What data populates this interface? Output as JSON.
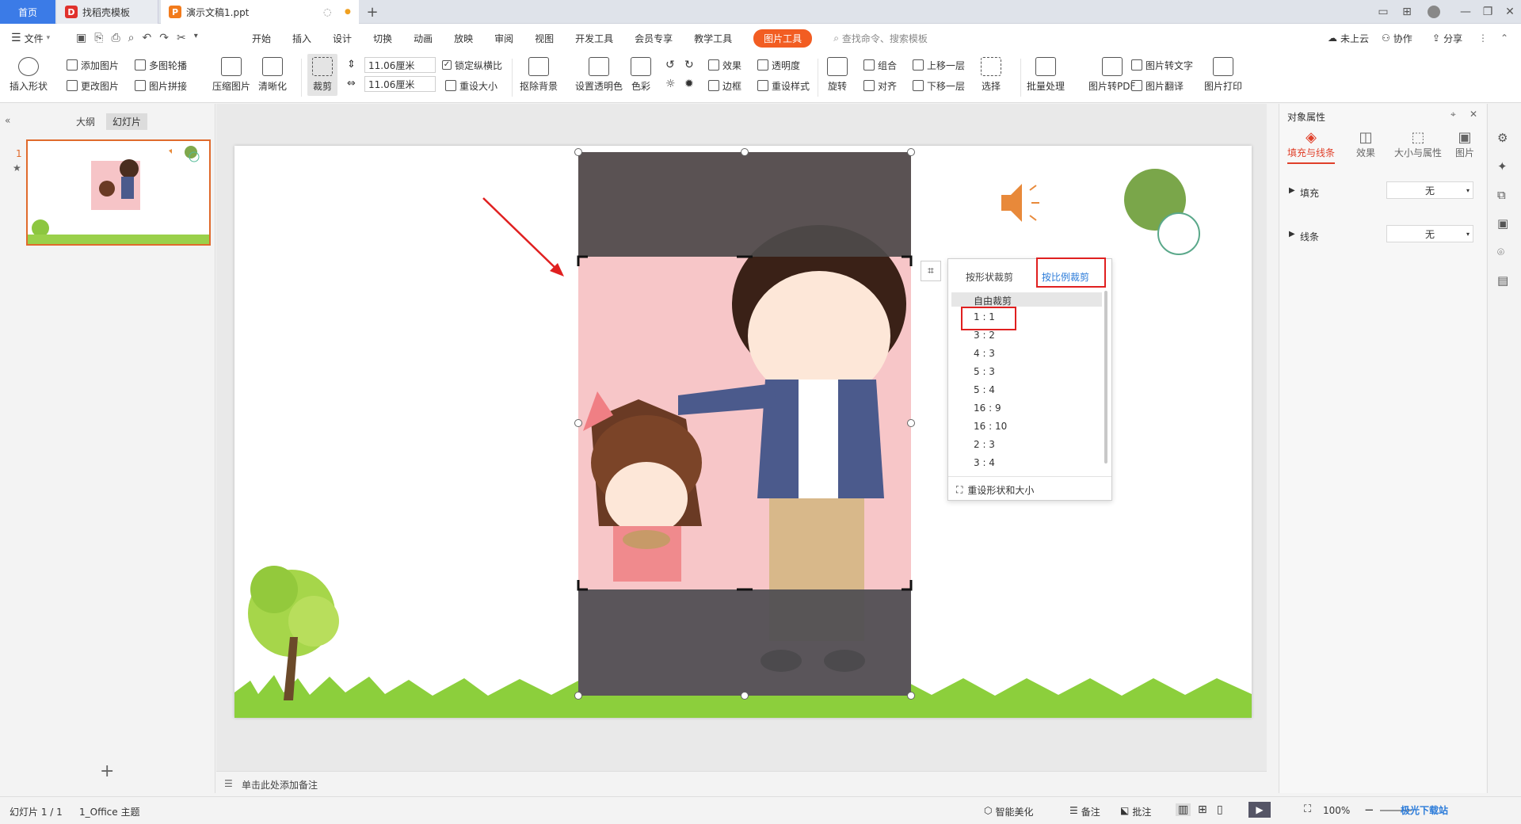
{
  "tabs": {
    "home": "首页",
    "templates": "找稻壳模板",
    "document": "演示文稿1.ppt"
  },
  "menu": {
    "file": "文件",
    "items": [
      "开始",
      "插入",
      "设计",
      "切换",
      "动画",
      "放映",
      "审阅",
      "视图",
      "开发工具",
      "会员专享",
      "教学工具"
    ],
    "active": "图片工具",
    "search": "查找命令、搜索模板",
    "cloud": "未上云",
    "collab": "协作",
    "share": "分享"
  },
  "ribbon": {
    "insert_shape": "插入形状",
    "add_picture": "添加图片",
    "change_picture": "更改图片",
    "multi_carousel": "多图轮播",
    "picture_splice": "图片拼接",
    "compress": "压缩图片",
    "clarify": "清晰化",
    "crop": "裁剪",
    "height_value": "11.06厘米",
    "width_value": "11.06厘米",
    "lock_ratio": "锁定纵横比",
    "reset_size": "重设大小",
    "remove_bg": "抠除背景",
    "set_transparent": "设置透明色",
    "color": "色彩",
    "effect": "效果",
    "transparency": "透明度",
    "border": "边框",
    "reset_style": "重设样式",
    "rotate": "旋转",
    "group": "组合",
    "align": "对齐",
    "bring_forward": "上移一层",
    "send_backward": "下移一层",
    "select": "选择",
    "batch": "批量处理",
    "to_pdf": "图片转PDF",
    "to_text": "图片转文字",
    "translate": "图片翻译",
    "print": "图片打印"
  },
  "leftpane": {
    "outline_tab": "大纲",
    "slides_tab": "幻灯片",
    "slide_number": "1"
  },
  "crop_menu": {
    "tab_shape": "按形状裁剪",
    "tab_ratio": "按比例裁剪",
    "free": "自由裁剪",
    "ratios": [
      "1 : 1",
      "3 : 2",
      "4 : 3",
      "5 : 3",
      "5 : 4",
      "16 : 9",
      "16 : 10",
      "2 : 3",
      "3 : 4"
    ],
    "reset": "重设形状和大小"
  },
  "rightpane": {
    "title": "对象属性",
    "tabs": [
      "填充与线条",
      "效果",
      "大小与属性",
      "图片"
    ],
    "fill_label": "填充",
    "fill_value": "无",
    "line_label": "线条",
    "line_value": "无"
  },
  "notes": {
    "placeholder": "单击此处添加备注"
  },
  "status": {
    "slide_info": "幻灯片 1 / 1",
    "theme": "1_Office 主题",
    "beautify": "智能美化",
    "notes": "备注",
    "comments": "批注",
    "zoom": "100%"
  },
  "watermark": "极光下载站",
  "colors": {
    "accent": "#f25d22",
    "home_tab": "#3b7be7",
    "highlight": "#e02020",
    "link_blue": "#2b7bd9"
  }
}
